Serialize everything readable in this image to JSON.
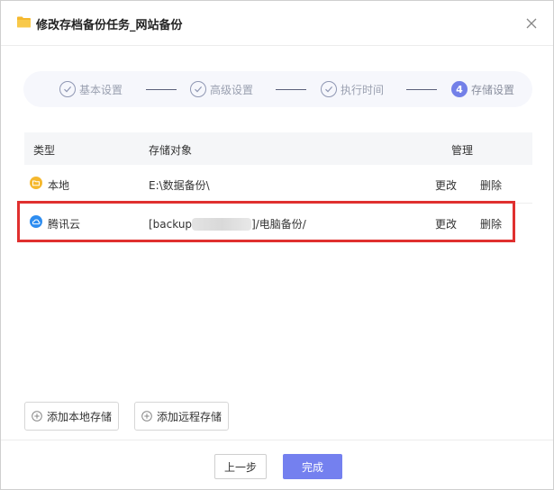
{
  "dialog": {
    "title": "修改存档备份任务_网站备份",
    "close_label": "×"
  },
  "steps": [
    {
      "label": "基本设置",
      "state": "done"
    },
    {
      "label": "高级设置",
      "state": "done"
    },
    {
      "label": "执行时间",
      "state": "done"
    },
    {
      "number": "4",
      "label": "存储设置",
      "state": "active"
    }
  ],
  "table": {
    "headers": [
      "类型",
      "存储对象",
      "管理"
    ],
    "rows": [
      {
        "type": "本地",
        "type_icon": "folder-icon",
        "target": "E:\\数据备份\\",
        "edit": "更改",
        "delete": "删除"
      },
      {
        "type": "腾讯云",
        "type_icon": "cloud-icon",
        "target_prefix": "[backup",
        "target_suffix": "]/电脑备份/",
        "edit": "更改",
        "delete": "删除"
      }
    ]
  },
  "actions": {
    "add_local": "添加本地存储",
    "add_remote": "添加远程存储"
  },
  "footer": {
    "prev": "上一步",
    "done": "完成"
  },
  "colors": {
    "accent": "#7480ef",
    "highlight": "#e0302f",
    "folder": "#f5b82e",
    "cloud": "#2e8df0"
  }
}
